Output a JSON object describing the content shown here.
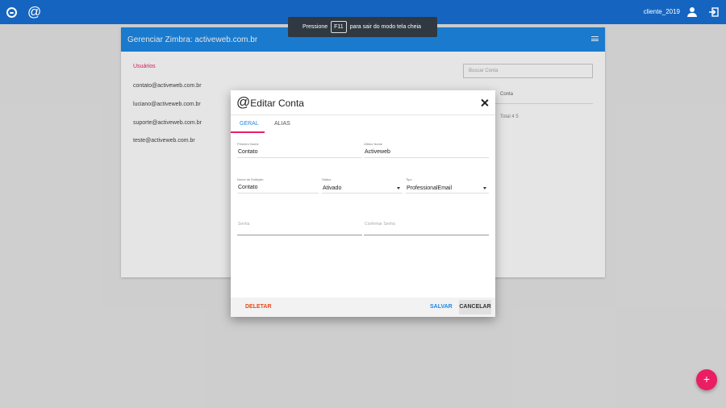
{
  "topbar": {
    "at_symbol": "@",
    "username": "cliente_2019"
  },
  "banner": {
    "prefix": "Pressione",
    "key": "F11",
    "suffix": "para sair do modo tela cheia"
  },
  "panel": {
    "title": "Gerenciar Zimbra: activeweb.com.br",
    "users_label": "Usuários",
    "users": [
      "contato@activeweb.com.br",
      "luciano@activeweb.com.br",
      "suporte@activeweb.com.br",
      "teste@activeweb.com.br"
    ],
    "search_placeholder": "Buscar Conta",
    "side_cell1": "Conta",
    "side_cell2": "Total 4 5"
  },
  "dialog": {
    "at_symbol": "@",
    "title": "Editar Conta",
    "tabs": [
      "GERAL",
      "ALIAS"
    ],
    "fields": {
      "primeiro_nome": {
        "label": "Primeiro Nome",
        "value": "Contato"
      },
      "ultimo_nome": {
        "label": "Último Nome",
        "value": "Activeweb"
      },
      "nome_exibicao": {
        "label": "Nome de Exibição",
        "value": "Contato"
      },
      "status": {
        "label": "Status",
        "value": "Ativado"
      },
      "tipo": {
        "label": "Tipo",
        "value": "ProfessionalEmail"
      },
      "senha": {
        "placeholder": "Senha"
      },
      "confirmar_senha": {
        "placeholder": "Confirmar Senha"
      }
    },
    "buttons": {
      "delete": "DELETAR",
      "save": "SALVAR",
      "cancel": "CANCELAR"
    }
  },
  "fab": {
    "label": "+"
  },
  "colors": {
    "topbar": "#1565c0",
    "panel_header": "#1e88e5",
    "accent": "#e91e63",
    "delete": "#e64a19"
  }
}
